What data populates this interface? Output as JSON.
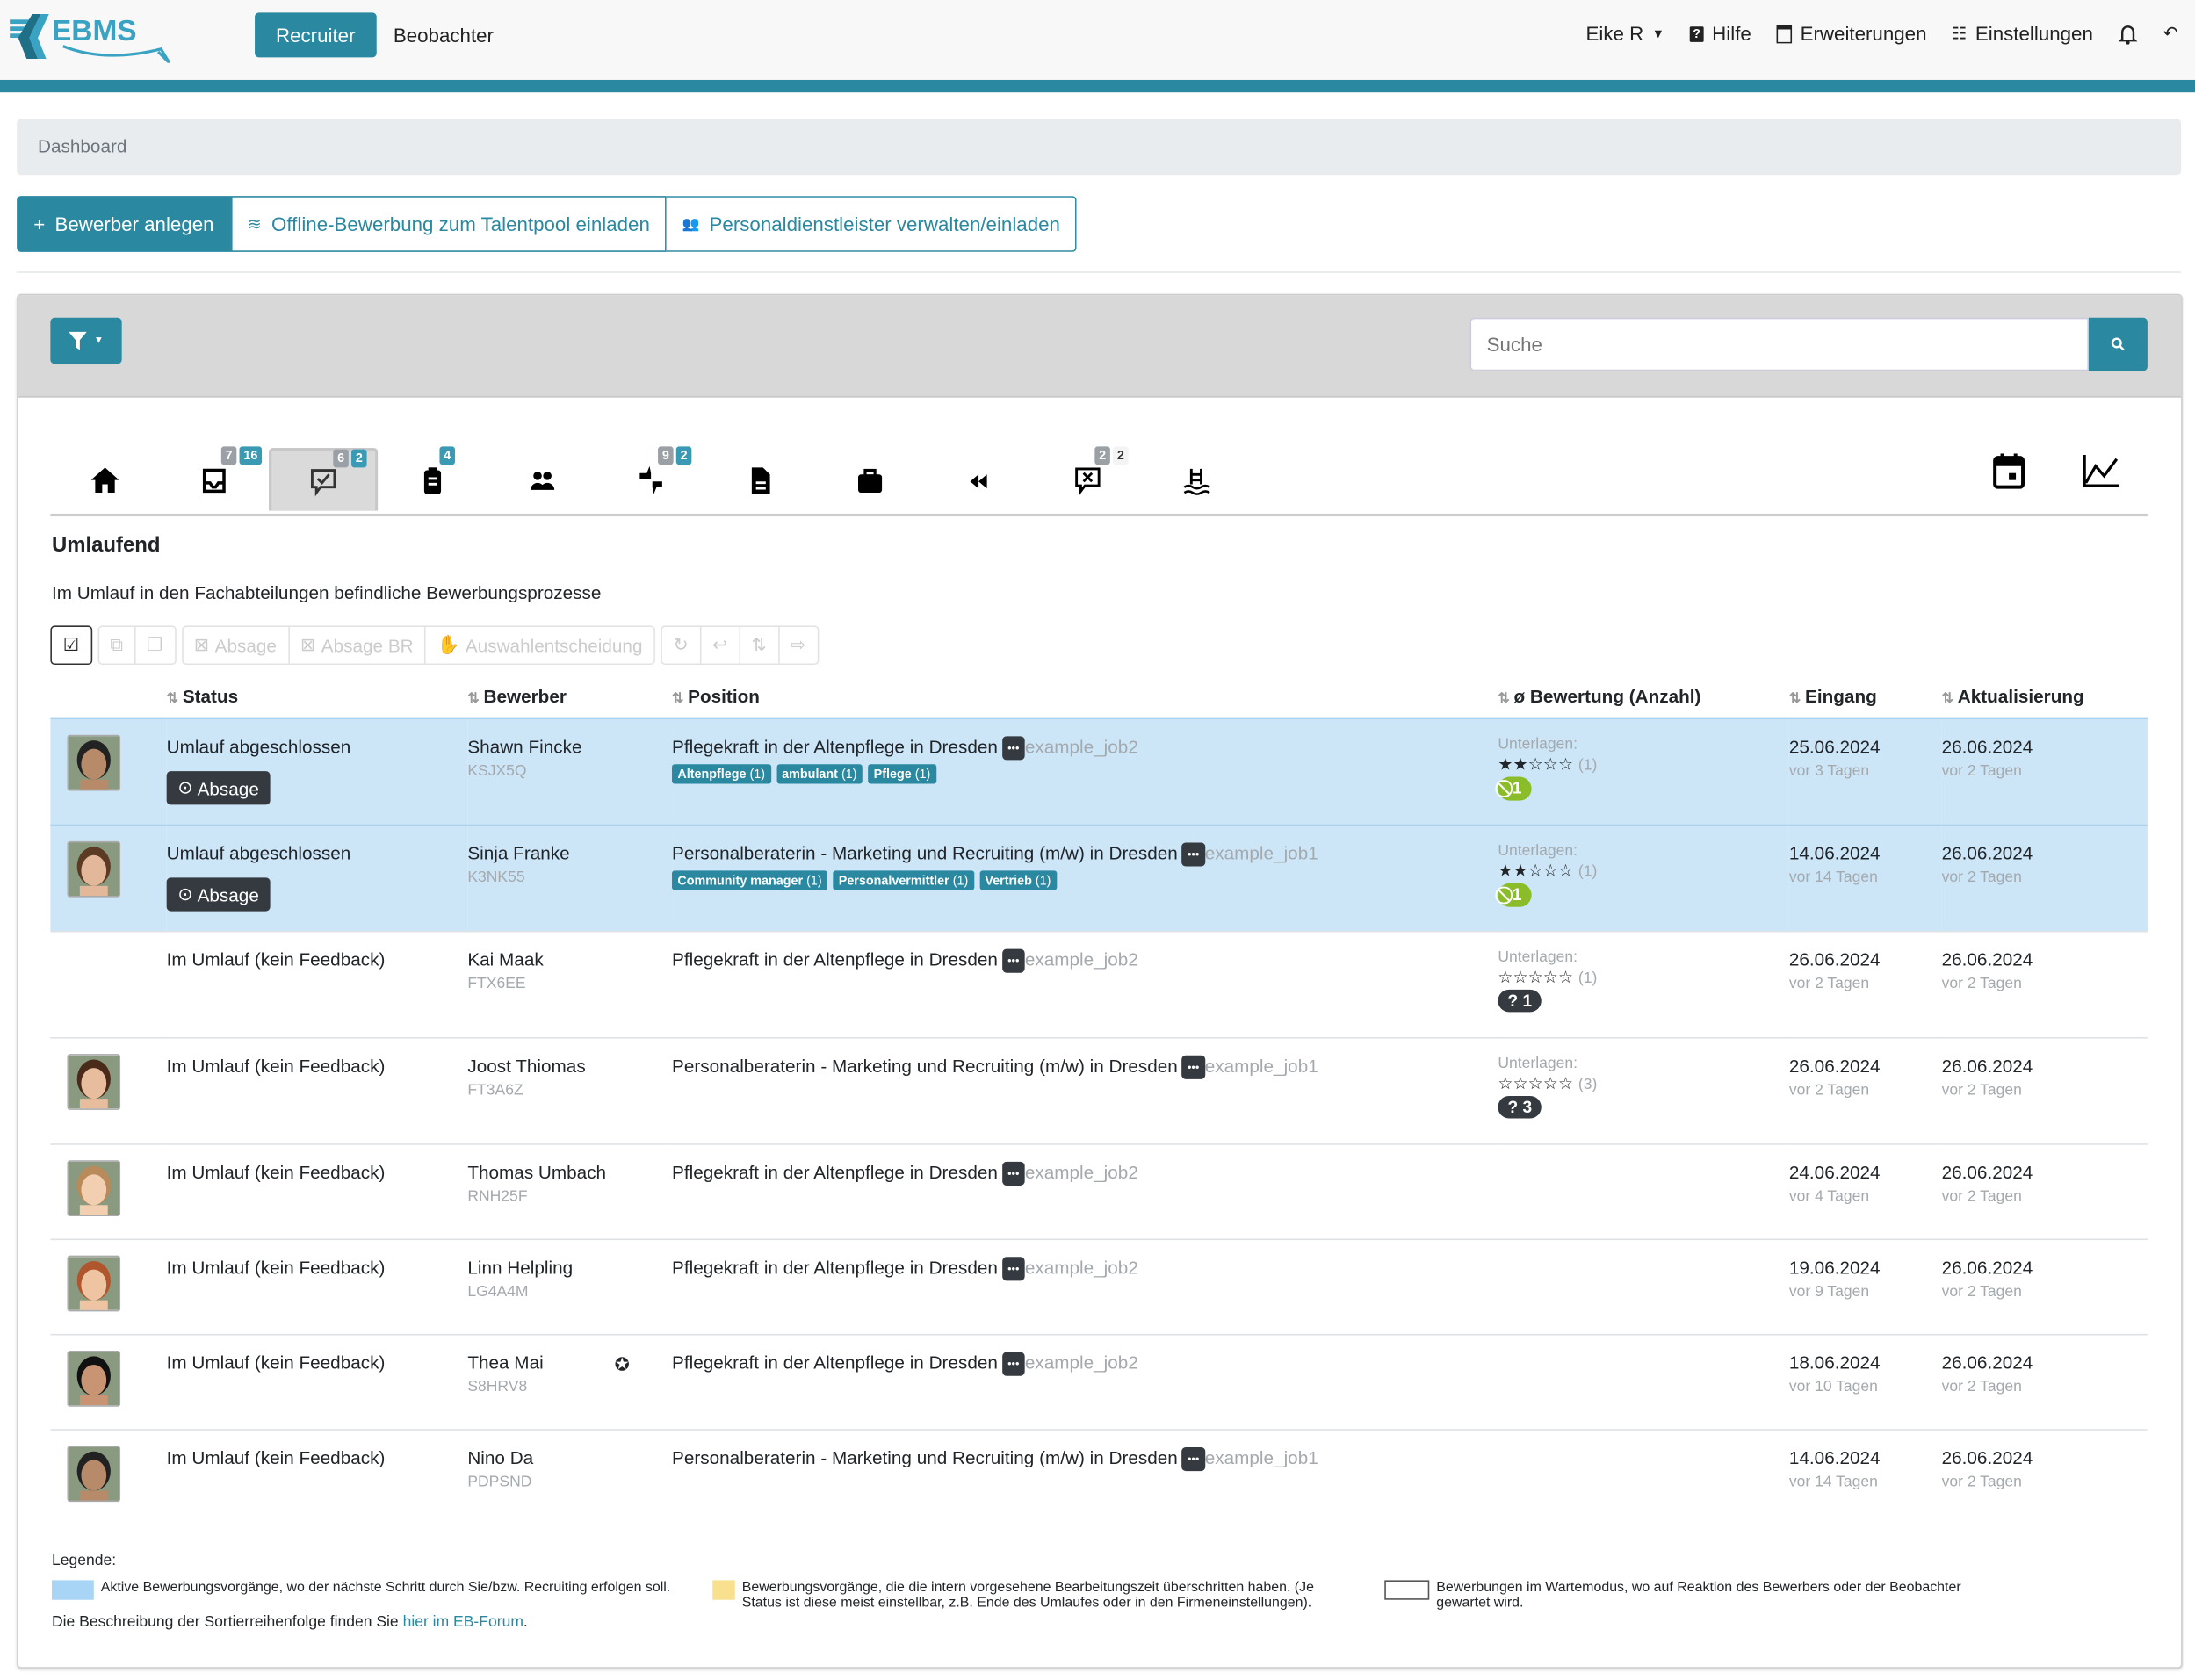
{
  "app": {
    "logo_text": "EBMS",
    "nav": [
      "Recruiter",
      "Beobachter"
    ],
    "user": "Eike R",
    "help": "Hilfe",
    "extensions": "Erweiterungen",
    "settings": "Einstellungen",
    "colors": {
      "accent": "#2a88a0",
      "highlight": "#cce6f8",
      "overdue": "#f8e08e"
    }
  },
  "breadcrumb": "Dashboard",
  "actions": [
    "Bewerber anlegen",
    "Offline-Bewerbung zum Talentpool einladen",
    "Personaldienstleister verwalten/einladen"
  ],
  "search": {
    "placeholder": "Suche"
  },
  "tabs": [
    {
      "icon": "home-icon",
      "badges": []
    },
    {
      "icon": "inbox-icon",
      "badges": [
        "7",
        "16"
      ]
    },
    {
      "icon": "comment-check-icon",
      "badges": [
        "6",
        "2"
      ],
      "active": true
    },
    {
      "icon": "clipboard-icon",
      "badges": [
        "4"
      ]
    },
    {
      "icon": "users-icon",
      "badges": []
    },
    {
      "icon": "thumbs-icon",
      "badges": [
        "9",
        "2"
      ]
    },
    {
      "icon": "document-icon",
      "badges": []
    },
    {
      "icon": "briefcase-icon",
      "badges": []
    },
    {
      "icon": "rewind-icon",
      "badges": []
    },
    {
      "icon": "comment-x-icon",
      "badges": [
        "2",
        "2"
      ]
    },
    {
      "icon": "pool-icon",
      "badges": []
    }
  ],
  "section": {
    "title": "Umlaufend",
    "description": "Im Umlauf in den Fachabteilungen befindliche Bewerbungsprozesse"
  },
  "toolbar": [
    "Absage",
    "Absage BR",
    "Auswahlentscheidung"
  ],
  "columns": [
    "Status",
    "Bewerber",
    "Position",
    "ø Bewertung (Anzahl)",
    "Eingang",
    "Aktualisierung"
  ],
  "rows": [
    {
      "status": "Umlauf abgeschlossen",
      "button": "Absage",
      "name": "Shawn Fincke",
      "code": "KSJX5Q",
      "position": "Pflegekraft in der Altenpflege in Dresden",
      "job": "example_job2",
      "tags": [
        [
          "Altenpflege",
          "(1)"
        ],
        [
          "ambulant",
          "(1)"
        ],
        [
          "Pflege",
          "(1)"
        ]
      ],
      "rating_label": "Unterlagen:",
      "stars": "★★☆☆☆",
      "count": "(1)",
      "pill": "1",
      "pill_type": "green",
      "eingang": "25.06.2024",
      "eingang_rel": "vor 3 Tagen",
      "akt": "26.06.2024",
      "akt_rel": "vor 2 Tagen",
      "hl": true
    },
    {
      "status": "Umlauf abgeschlossen",
      "button": "Absage",
      "name": "Sinja Franke",
      "code": "K3NK55",
      "position": "Personalberaterin - Marketing und Recruiting (m/w) in Dresden",
      "job": "example_job1",
      "tags": [
        [
          "Community manager",
          "(1)"
        ],
        [
          "Personalvermittler",
          "(1)"
        ],
        [
          "Vertrieb",
          "(1)"
        ]
      ],
      "rating_label": "Unterlagen:",
      "stars": "★★☆☆☆",
      "count": "(1)",
      "pill": "1",
      "pill_type": "green",
      "eingang": "14.06.2024",
      "eingang_rel": "vor 14 Tagen",
      "akt": "26.06.2024",
      "akt_rel": "vor 2 Tagen",
      "hl": true
    },
    {
      "status": "Im Umlauf (kein Feedback)",
      "name": "Kai Maak",
      "code": "FTX6EE",
      "position": "Pflegekraft in der Altenpflege in Dresden",
      "job": "example_job2",
      "rating_label": "Unterlagen:",
      "stars": "☆☆☆☆☆",
      "count": "(1)",
      "pill": "1",
      "pill_type": "dark",
      "eingang": "26.06.2024",
      "eingang_rel": "vor 2 Tagen",
      "akt": "26.06.2024",
      "akt_rel": "vor 2 Tagen",
      "noavatar": true
    },
    {
      "status": "Im Umlauf (kein Feedback)",
      "name": "Joost Thiomas",
      "code": "FT3A6Z",
      "position": "Personalberaterin - Marketing und Recruiting (m/w) in Dresden",
      "job": "example_job1",
      "rating_label": "Unterlagen:",
      "stars": "☆☆☆☆☆",
      "count": "(3)",
      "pill": "3",
      "pill_type": "dark",
      "eingang": "26.06.2024",
      "eingang_rel": "vor 2 Tagen",
      "akt": "26.06.2024",
      "akt_rel": "vor 2 Tagen"
    },
    {
      "status": "Im Umlauf (kein Feedback)",
      "name": "Thomas Umbach",
      "code": "RNH25F",
      "position": "Pflegekraft in der Altenpflege in Dresden",
      "job": "example_job2",
      "eingang": "24.06.2024",
      "eingang_rel": "vor 4 Tagen",
      "akt": "26.06.2024",
      "akt_rel": "vor 2 Tagen"
    },
    {
      "status": "Im Umlauf (kein Feedback)",
      "name": "Linn Helpling",
      "code": "LG4A4M",
      "position": "Pflegekraft in der Altenpflege in Dresden",
      "job": "example_job2",
      "eingang": "19.06.2024",
      "eingang_rel": "vor 9 Tagen",
      "akt": "26.06.2024",
      "akt_rel": "vor 2 Tagen"
    },
    {
      "status": "Im Umlauf (kein Feedback)",
      "name": "Thea Mai",
      "code": "S8HRV8",
      "star_badge": true,
      "position": "Pflegekraft in der Altenpflege in Dresden",
      "job": "example_job2",
      "eingang": "18.06.2024",
      "eingang_rel": "vor 10 Tagen",
      "akt": "26.06.2024",
      "akt_rel": "vor 2 Tagen"
    },
    {
      "status": "Im Umlauf (kein Feedback)",
      "name": "Nino Da",
      "code": "PDPSND",
      "position": "Personalberaterin - Marketing und Recruiting (m/w) in Dresden",
      "job": "example_job1",
      "eingang": "14.06.2024",
      "eingang_rel": "vor 14 Tagen",
      "akt": "26.06.2024",
      "akt_rel": "vor 2 Tagen"
    }
  ],
  "legend": {
    "title": "Legende:",
    "items": [
      "Aktive Bewerbungsvorgänge, wo der nächste Schritt durch Sie/bzw. Recruiting erfolgen soll.",
      "Bewerbungsvorgänge, die die intern vorgesehene Bearbeitungszeit überschritten haben. (Je Status ist diese meist einstellbar, z.B. Ende des Umlaufes oder in den Firmeneinstellungen).",
      "Bewerbungen im Wartemodus, wo auf Reaktion des Bewerbers oder der Beobachter gewartet wird."
    ],
    "sort_text": "Die Beschreibung der Sortierreihenfolge finden Sie",
    "sort_link": "hier im EB-Forum",
    "sort_end": "."
  }
}
